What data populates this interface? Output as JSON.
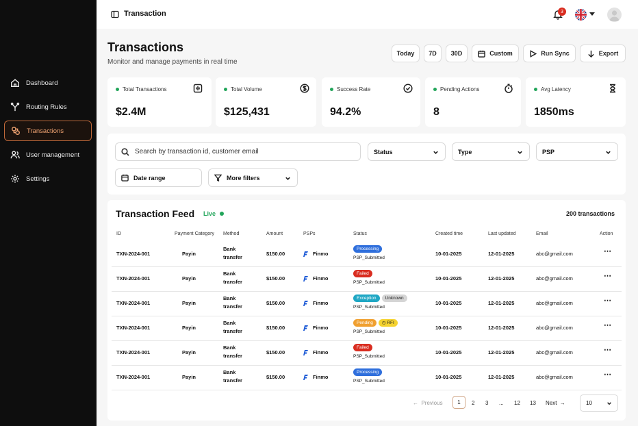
{
  "sidebar": {
    "items": [
      {
        "label": "Dashboard",
        "icon": "home-icon",
        "active": false
      },
      {
        "label": "Routing Rules",
        "icon": "routing-icon",
        "active": false
      },
      {
        "label": "Transactions",
        "icon": "transactions-icon",
        "active": true
      },
      {
        "label": "User management",
        "icon": "users-icon",
        "active": false
      },
      {
        "label": "Settings",
        "icon": "gear-icon",
        "active": false
      }
    ]
  },
  "topbar": {
    "title": "Transaction",
    "notification_count": "3",
    "language_flag": "uk-flag"
  },
  "header": {
    "title": "Transactions",
    "subtitle": "Monitor and manage payments in real time",
    "buttons": {
      "today": "Today",
      "d7": "7D",
      "d30": "30D",
      "custom": "Custom",
      "run_sync": "Run Sync",
      "export": "Export"
    }
  },
  "stats": [
    {
      "label": "Total Transactions",
      "value": "$2.4M",
      "icon": "columns-icon"
    },
    {
      "label": "Total Volume",
      "value": "$125,431",
      "icon": "dollar-icon"
    },
    {
      "label": "Success Rate",
      "value": "94.2%",
      "icon": "check-circle-icon"
    },
    {
      "label": "Pending Actions",
      "value": "8",
      "icon": "timer-icon"
    },
    {
      "label": "Avg Latency",
      "value": "1850ms",
      "icon": "hourglass-icon"
    }
  ],
  "filters": {
    "search_placeholder": "Search by transaction id, customer email",
    "status": "Status",
    "type": "Type",
    "psp": "PSP",
    "date_range": "Date range",
    "more_filters": "More filters"
  },
  "feed": {
    "title": "Transaction Feed",
    "live": "Live",
    "count": "200 transactions",
    "columns": [
      "ID",
      "Payment Category",
      "Method",
      "Amount",
      "PSPs",
      "Status",
      "Created time",
      "Last updated",
      "Email",
      "Action"
    ],
    "rows": [
      {
        "id": "TXN-2024-001",
        "category": "Payin",
        "method1": "Bank",
        "method2": "transfer",
        "amount": "$150.00",
        "psp": "Finmo",
        "pills": [
          {
            "text": "Processing",
            "color": "#2f6fdc"
          }
        ],
        "sub": "PSP_Submitted",
        "created": "10-01-2025",
        "updated": "12-01-2025",
        "email": "abc@gmail.com"
      },
      {
        "id": "TXN-2024-001",
        "category": "Payin",
        "method1": "Bank",
        "method2": "transfer",
        "amount": "$150.00",
        "psp": "Finmo",
        "pills": [
          {
            "text": "Failed",
            "color": "#d92d20"
          }
        ],
        "sub": "PSP_Submitted",
        "created": "10-01-2025",
        "updated": "12-01-2025",
        "email": "abc@gmail.com"
      },
      {
        "id": "TXN-2024-001",
        "category": "Payin",
        "method1": "Bank",
        "method2": "transfer",
        "amount": "$150.00",
        "psp": "Finmo",
        "pills": [
          {
            "text": "Exception",
            "color": "#1fa7c4"
          },
          {
            "text": "Unknown",
            "color": "#d5d5d5"
          }
        ],
        "sub": "PSP_Submitted",
        "created": "10-01-2025",
        "updated": "12-01-2025",
        "email": "abc@gmail.com"
      },
      {
        "id": "TXN-2024-001",
        "category": "Payin",
        "method1": "Bank",
        "method2": "transfer",
        "amount": "$150.00",
        "psp": "Finmo",
        "pills": [
          {
            "text": "Pending",
            "color": "#f0a030"
          },
          {
            "text": "RFI",
            "color": "#f5d330"
          }
        ],
        "sub": "PSP_Submitted",
        "created": "10-01-2025",
        "updated": "12-01-2025",
        "email": "abc@gmail.com"
      },
      {
        "id": "TXN-2024-001",
        "category": "Payin",
        "method1": "Bank",
        "method2": "transfer",
        "amount": "$150.00",
        "psp": "Finmo",
        "pills": [
          {
            "text": "Failed",
            "color": "#d92d20"
          }
        ],
        "sub": "PSP_Submitted",
        "created": "10-01-2025",
        "updated": "12-01-2025",
        "email": "abc@gmail.com"
      },
      {
        "id": "TXN-2024-001",
        "category": "Payin",
        "method1": "Bank",
        "method2": "transfer",
        "amount": "$150.00",
        "psp": "Finmo",
        "pills": [
          {
            "text": "Processing",
            "color": "#2f6fdc"
          }
        ],
        "sub": "PSP_Submitted",
        "created": "10-01-2025",
        "updated": "12-01-2025",
        "email": "abc@gmail.com"
      }
    ]
  },
  "pagination": {
    "previous": "Previous",
    "pages": [
      "1",
      "2",
      "3",
      "...",
      "12",
      "13"
    ],
    "next": "Next",
    "per_page": "10"
  },
  "colors": {
    "accent": "#c0693a",
    "live": "#22a55a",
    "sidebar_bg": "#0e0e0e"
  }
}
